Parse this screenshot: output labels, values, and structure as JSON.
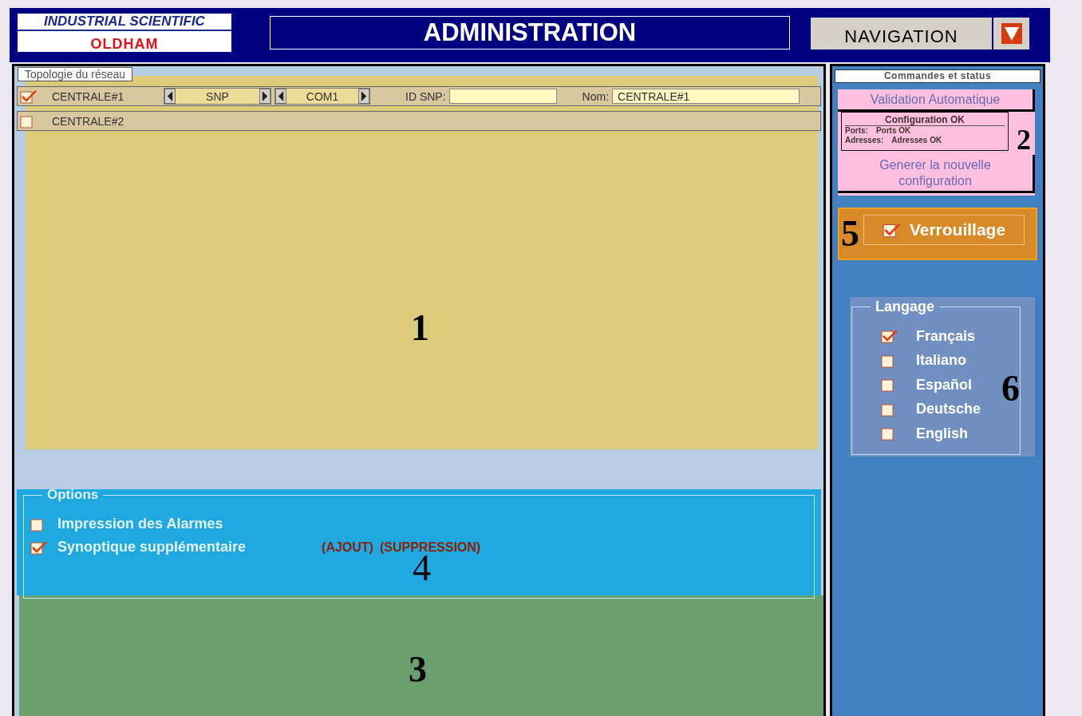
{
  "header": {
    "logo_top": "INDUSTRIAL SCIENTIFIC",
    "logo_bottom": "OLDHAM",
    "title": "ADMINISTRATION",
    "navigation": "NAVIGATION"
  },
  "topology": {
    "title": "Topologie du réseau",
    "centrales": [
      {
        "name": "CENTRALE#1",
        "checked": true,
        "protocol": "SNP",
        "port": "COM1",
        "id_label": "ID SNP:",
        "name_label": "Nom:",
        "name_value": "CENTRALE#1"
      },
      {
        "name": "CENTRALE#2",
        "checked": false
      }
    ]
  },
  "options": {
    "title": "Options",
    "items": [
      {
        "label": "Impression des Alarmes",
        "checked": false
      },
      {
        "label": "Synoptique supplémentaire",
        "checked": true
      }
    ],
    "links": [
      "(AJOUT)",
      "(SUPPRESSION)"
    ]
  },
  "commands": {
    "title": "Commandes et status",
    "validation": {
      "label": "Validation Automatique",
      "status": "Configuration OK",
      "lines": [
        {
          "label": "Ports:",
          "value": "Ports OK"
        },
        {
          "label": "Adresses:",
          "value": "Adresses OK"
        }
      ]
    },
    "generate": "Generer la nouvelle configuration",
    "lock": {
      "label": "Verrouillage",
      "checked": true
    }
  },
  "language": {
    "title": "Langage",
    "items": [
      {
        "label": "Français",
        "selected": true
      },
      {
        "label": "Italiano",
        "selected": false
      },
      {
        "label": "Español",
        "selected": false
      },
      {
        "label": "Deutsche",
        "selected": false
      },
      {
        "label": "English",
        "selected": false
      }
    ]
  },
  "annotations": [
    {
      "label": "2",
      "kind": "commands",
      "color": "#ffc0e0"
    },
    {
      "label": "5",
      "kind": "lock",
      "color": "#d88a28"
    },
    {
      "label": "1",
      "kind": "topology",
      "color": "#dccb7a"
    },
    {
      "label": "6",
      "kind": "language",
      "color": "#6f90c0"
    },
    {
      "label": "4",
      "kind": "options",
      "color": "#20a8e0"
    },
    {
      "label": "3",
      "kind": "synoptic",
      "color": "#6aa070"
    }
  ]
}
